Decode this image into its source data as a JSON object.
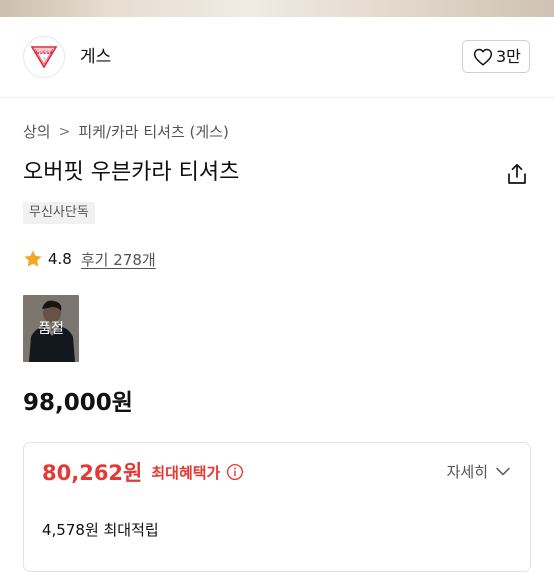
{
  "brand": {
    "logo_text": "GUESS",
    "name": "게스",
    "like_count": "3만",
    "accent_color": "#e2233a"
  },
  "breadcrumb": {
    "category": "상의",
    "separator": ">",
    "subcategory": "피케/카라 티셔츠 (게스)"
  },
  "product": {
    "title": "오버핏 우븐카라 티셔츠",
    "tag": "무신사단독",
    "rating": "4.8",
    "reviews": "후기 278개",
    "option_status": "품절",
    "price": "98,000원"
  },
  "benefit": {
    "sale_price": "80,262원",
    "max_label": "최대혜택가",
    "detail_label": "자세히",
    "points": "4,578원 최대적립",
    "sale_color": "#e53935"
  },
  "icons": {
    "like": "heart-icon",
    "share": "share-icon",
    "star": "star-icon",
    "info": "info-icon",
    "expand": "chevron-down-icon"
  }
}
